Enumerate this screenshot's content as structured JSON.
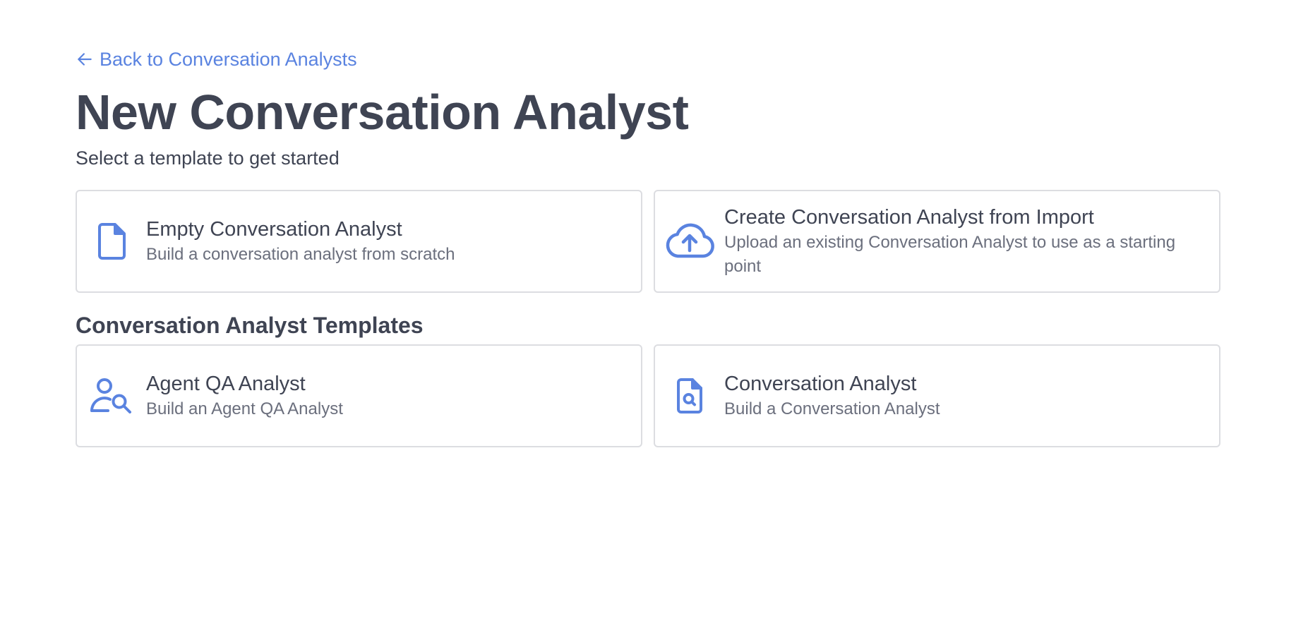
{
  "header": {
    "back_link": "Back to Conversation Analysts",
    "title": "New Conversation Analyst",
    "subtitle": "Select a template to get started"
  },
  "start_options": [
    {
      "icon": "document-icon",
      "title": "Empty Conversation Analyst",
      "description": "Build a conversation analyst from scratch"
    },
    {
      "icon": "cloud-upload-icon",
      "title": "Create Conversation Analyst from Import",
      "description": "Upload an existing Conversation Analyst to use as a starting point"
    }
  ],
  "templates_section": {
    "title": "Conversation Analyst Templates",
    "items": [
      {
        "icon": "user-search-icon",
        "title": "Agent QA Analyst",
        "description": "Build an Agent QA Analyst"
      },
      {
        "icon": "document-search-icon",
        "title": "Conversation Analyst",
        "description": "Build a Conversation Analyst"
      }
    ]
  },
  "colors": {
    "accent": "#5a83e0",
    "text": "#3f4453",
    "muted_text": "#6b6f7d",
    "border": "#dcdde1"
  }
}
